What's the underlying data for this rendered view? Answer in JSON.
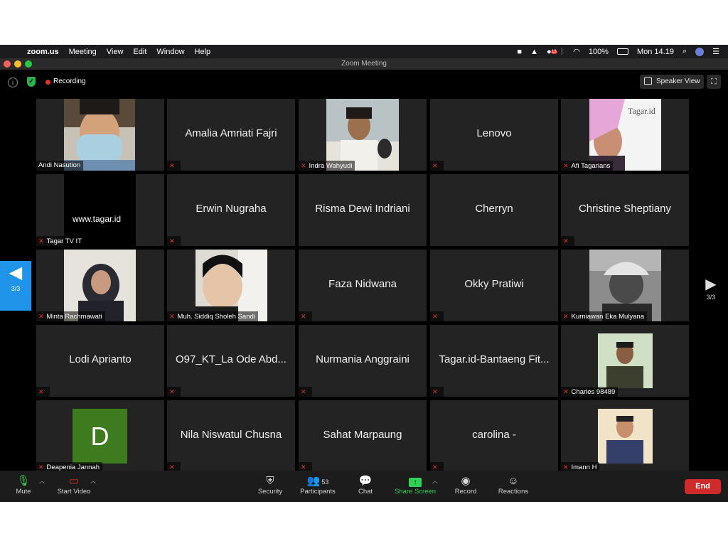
{
  "menubar": {
    "app": "zoom.us",
    "items": [
      "Meeting",
      "View",
      "Edit",
      "Window",
      "Help"
    ],
    "notification_count": "13",
    "battery": "100%",
    "clock": "Mon 14.19"
  },
  "window": {
    "title": "Zoom Meeting",
    "recording_label": "Recording",
    "view_button": "Speaker View"
  },
  "pager": {
    "left": "3/3",
    "right": "3/3"
  },
  "participants": [
    {
      "name": "Andi Nasution",
      "video": true
    },
    {
      "name": "Amalia Amriati Fajri",
      "video": false
    },
    {
      "name": "Indra Wahyudi",
      "video": true
    },
    {
      "name": "Lenovo",
      "video": false
    },
    {
      "name": "Afi Tagarians",
      "video": true
    },
    {
      "name": "Tagar TV IT",
      "video": true,
      "overlay_text": "www.tagar.id"
    },
    {
      "name": "Erwin Nugraha",
      "video": false
    },
    {
      "name": "Risma Dewi Indriani",
      "video": false
    },
    {
      "name": "Cherryn",
      "video": false
    },
    {
      "name": "Christine Sheptiany",
      "video": false
    },
    {
      "name": "Minta Rachmawati",
      "video": true
    },
    {
      "name": "Muh. Siddiq Sholeh Sandi",
      "video": true
    },
    {
      "name": "Faza Nidwana",
      "video": false
    },
    {
      "name": "Okky Pratiwi",
      "video": false
    },
    {
      "name": "Kurniawan Eka Mulyana",
      "video": true
    },
    {
      "name": "Lodi Aprianto",
      "video": false
    },
    {
      "name": "O97_KT_La Ode Abd...",
      "video": false
    },
    {
      "name": "Nurmania Anggraini",
      "video": false
    },
    {
      "name": "Tagar.id-Bantaeng Fit...",
      "video": false
    },
    {
      "name": "Charles 98489",
      "video": true
    },
    {
      "name": "Deapenia Jannah",
      "video": false,
      "avatar_letter": "D"
    },
    {
      "name": "Nila Niswatul Chusna",
      "video": false
    },
    {
      "name": "Sahat Marpaung",
      "video": false
    },
    {
      "name": "carolina -",
      "video": false
    },
    {
      "name": "Imann H",
      "video": true
    }
  ],
  "afi_watermark": "Tagar.id",
  "toolbar": {
    "mute": "Mute",
    "start_video": "Start Video",
    "security": "Security",
    "participants": "Participants",
    "participant_count": "53",
    "chat": "Chat",
    "share_screen": "Share Screen",
    "record": "Record",
    "reactions": "Reactions",
    "end": "End"
  },
  "colors": {
    "accent_green": "#2fd158",
    "end_red": "#cf2b2b",
    "pager_blue": "#1f94e8",
    "tile_bg": "#232323"
  }
}
